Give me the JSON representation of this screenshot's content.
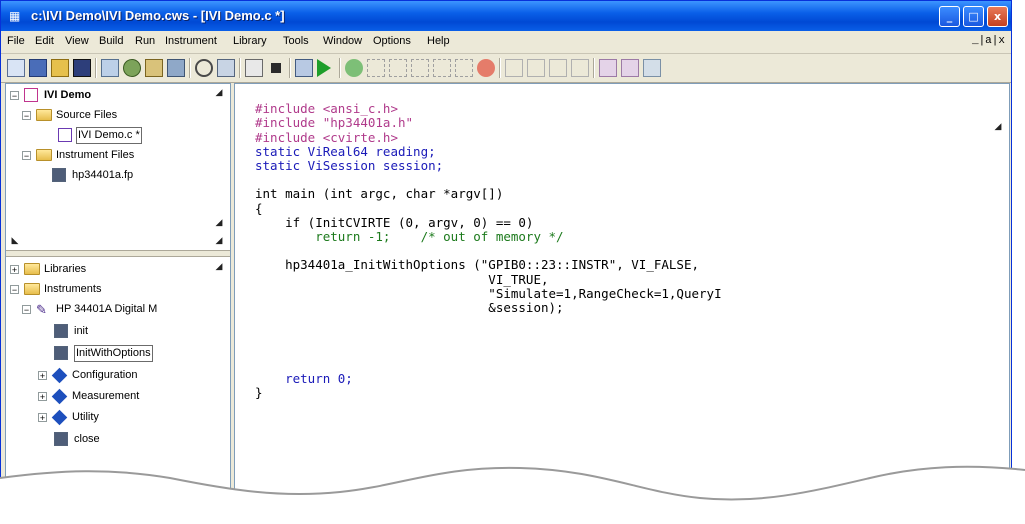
{
  "window": {
    "title": "c:\\IVI Demo\\IVI Demo.cws - [IVI Demo.c *]",
    "controls": [
      "_",
      "□",
      "x"
    ]
  },
  "menubar": {
    "items": [
      "File",
      "Edit",
      "View",
      "Build",
      "Run",
      "Instrument",
      "Library",
      "Tools",
      "Window",
      "Options",
      "Help"
    ],
    "mdi_controls": "_|a|x"
  },
  "toolbar": {
    "icons": [
      "new-project-icon",
      "open-file-icon",
      "open-folder-icon",
      "save-icon",
      "cut-icon",
      "build-icon",
      "find-icon",
      "window-icon",
      "magnify-icon",
      "replace-icon",
      "debug-icon",
      "stop-icon",
      "step-icon",
      "run-icon",
      "breakpoint-icon",
      "step-into-icon",
      "step-over-icon",
      "step-out-icon",
      "goto-cursor-icon",
      "continue-icon",
      "terminate-icon",
      "watch-icon",
      "variables-icon",
      "call-stack-icon",
      "memory-icon",
      "panel-icon",
      "function-panel-icon",
      "help-icon"
    ]
  },
  "project_tree": {
    "root": "IVI Demo",
    "source_files": "Source Files",
    "source_file_item": "IVI Demo.c *",
    "instrument_files": "Instrument Files",
    "instrument_file_item": "hp34401a.fp"
  },
  "library_tree": {
    "libraries": "Libraries",
    "instruments": "Instruments",
    "instrument": "HP 34401A Digital M",
    "functions": [
      "init",
      "InitWithOptions"
    ],
    "classes": [
      "Configuration",
      "Measurement",
      "Utility"
    ],
    "close": "close"
  },
  "editor": {
    "lines": [
      "#include <ansi_c.h>",
      "#include \"hp34401a.h\"",
      "#include <cvirte.h>",
      "static ViReal64 reading;",
      "static ViSession session;",
      "",
      "int main (int argc, char *argv[])",
      "{",
      "    if (InitCVIRTE (0, argv, 0) == 0)",
      "        return -1;    /* out of memory */",
      "",
      "    hp34401a_InitWithOptions (\"GPIB0::23::INSTR\", VI_FALSE,",
      "                               VI_TRUE,",
      "                               \"Simulate=1,RangeCheck=1,QueryI",
      "                               &session);",
      "",
      "",
      "",
      "",
      "    return 0;",
      "}"
    ]
  },
  "colors": {
    "title_bar": "#0a5fe8",
    "preprocessor": "#b03a8b",
    "keyword": "#1a1ab8",
    "comment": "#1c7a1c"
  }
}
